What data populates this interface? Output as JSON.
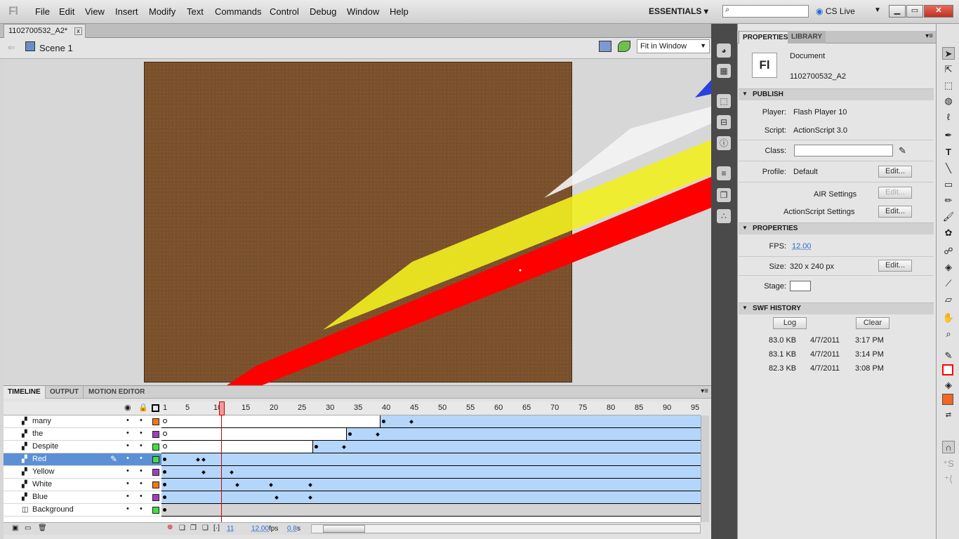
{
  "app": {
    "logo": "Fl",
    "workspace": "ESSENTIALS",
    "cs_live": "CS Live"
  },
  "menu": [
    "File",
    "Edit",
    "View",
    "Insert",
    "Modify",
    "Text",
    "Commands",
    "Control",
    "Debug",
    "Window",
    "Help"
  ],
  "window_buttons": {
    "minimize": "▁",
    "restore": "▭",
    "close": "✕"
  },
  "document": {
    "tab": "1102700532_A2*",
    "scene": "Scene 1",
    "zoom": "Fit in Window"
  },
  "panel_tabs": [
    "PROPERTIES",
    "LIBRARY"
  ],
  "properties": {
    "type": "Document",
    "doc_name": "1102700532_A2",
    "publish": {
      "header": "PUBLISH",
      "player_label": "Player:",
      "player": "Flash Player 10",
      "script_label": "Script:",
      "script": "ActionScript 3.0",
      "class_label": "Class:",
      "profile_label": "Profile:",
      "profile": "Default",
      "edit_label": "Edit...",
      "air_label": "AIR Settings",
      "as_label": "ActionScript Settings"
    },
    "props": {
      "header": "PROPERTIES",
      "fps_label": "FPS:",
      "fps": "12.00",
      "size_label": "Size:",
      "size": "320 x 240 px",
      "stage_label": "Stage:",
      "stage_color": "#ffffff"
    },
    "swf": {
      "header": "SWF HISTORY",
      "log": "Log",
      "clear": "Clear",
      "rows": [
        {
          "size": "83.0 KB",
          "date": "4/7/2011",
          "time": "3:17 PM"
        },
        {
          "size": "83.1 KB",
          "date": "4/7/2011",
          "time": "3:14 PM"
        },
        {
          "size": "82.3 KB",
          "date": "4/7/2011",
          "time": "3:08 PM"
        }
      ]
    }
  },
  "timeline": {
    "tabs": [
      "TIMELINE",
      "OUTPUT",
      "MOTION EDITOR"
    ],
    "ruler": [
      "1",
      "5",
      "10",
      "15",
      "20",
      "25",
      "30",
      "35",
      "40",
      "45",
      "50",
      "55",
      "60",
      "65",
      "70",
      "75",
      "80",
      "85",
      "90",
      "95"
    ],
    "layers": [
      {
        "name": "many",
        "color": "#f07a12"
      },
      {
        "name": "the",
        "color": "#a040c0"
      },
      {
        "name": "Despite",
        "color": "#40e040"
      },
      {
        "name": "Red",
        "color": "#40e040"
      },
      {
        "name": "Yellow",
        "color": "#a040c0"
      },
      {
        "name": "White",
        "color": "#f07a12"
      },
      {
        "name": "Blue",
        "color": "#a040c0"
      },
      {
        "name": "Background",
        "color": "#40e040"
      }
    ],
    "current_frame": "11",
    "fps": "12.00",
    "fps_unit": "fps",
    "elapsed": "0.8",
    "elapsed_unit": "s"
  },
  "colors": {
    "stroke_color": "#ff0000",
    "fill_color": "#f26522"
  }
}
